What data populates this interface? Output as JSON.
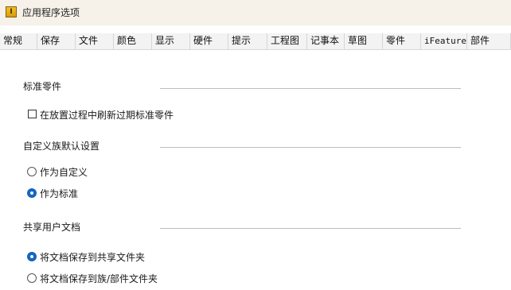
{
  "window": {
    "title": "应用程序选项",
    "icon_label": "I"
  },
  "tabs": [
    "常规",
    "保存",
    "文件",
    "颜色",
    "显示",
    "硬件",
    "提示",
    "工程图",
    "记事本",
    "草图",
    "零件",
    "iFeature",
    "部件"
  ],
  "sections": {
    "standard_parts": {
      "title": "标准零件",
      "refresh_checkbox": {
        "label": "在放置过程中刷新过期标准零件",
        "checked": false
      }
    },
    "family_default": {
      "title": "自定义族默认设置",
      "options": [
        {
          "label": "作为自定义",
          "checked": false
        },
        {
          "label": "作为标准",
          "checked": true
        }
      ]
    },
    "shared_docs": {
      "title": "共享用户文档",
      "options": [
        {
          "label": "将文档保存到共享文件夹",
          "checked": true
        },
        {
          "label": "将文档保存到族/部件文件夹",
          "checked": false
        }
      ]
    }
  },
  "colors": {
    "accent": "#1565c0",
    "title_bg": "#f6f1e9",
    "tab_bg": "#f3f3f3"
  }
}
